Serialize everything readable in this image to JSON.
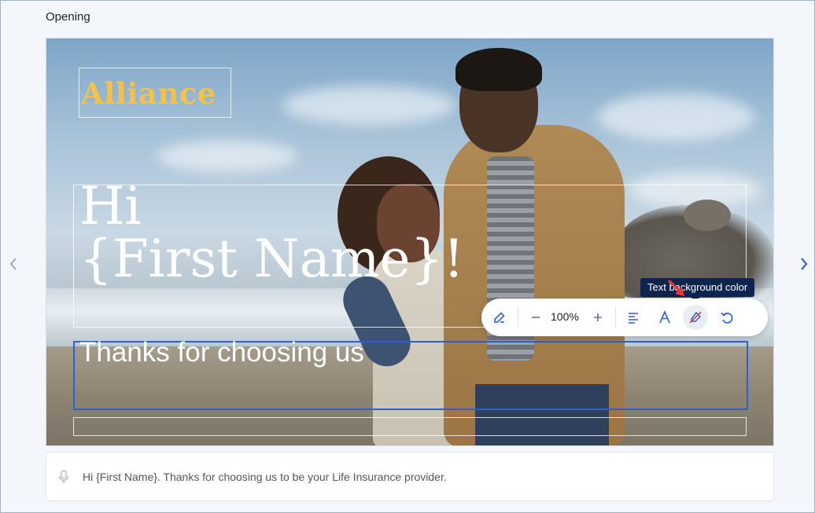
{
  "section": {
    "title": "Opening"
  },
  "slide": {
    "logo_text": "Alliance",
    "greeting": "Hi\n{First Name}!",
    "subtitle": "Thanks for choosing us"
  },
  "toolbar": {
    "zoom_value": "100%",
    "buttons": [
      "edit-icon",
      "zoom-out-icon",
      "zoom-in-icon",
      "align-left-icon",
      "text-color-icon",
      "text-background-color-icon",
      "undo-icon"
    ],
    "tooltip": "Text background color",
    "accent_color": "#2f5fd4"
  },
  "nav": {
    "prev": "chevron-left-icon",
    "next": "chevron-right-icon"
  },
  "transcript": {
    "text": "Hi {First Name}. Thanks for choosing us to be your Life Insurance provider."
  },
  "colors": {
    "logo": "#f3c24a",
    "selection_border": "#2f5fd4",
    "tooltip_bg": "#0d2350",
    "arrow": "#e53935"
  }
}
